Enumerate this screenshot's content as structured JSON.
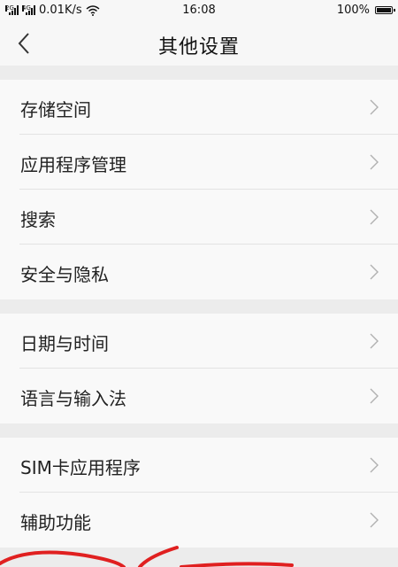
{
  "status_bar": {
    "sim1_tag": "2G",
    "sim2_tag": "4G",
    "net_speed": "0.01K/s",
    "time": "16:08",
    "battery": "100%",
    "icons": [
      "signal-icon",
      "wifi-icon",
      "battery-icon"
    ]
  },
  "header": {
    "title": "其他设置",
    "back_icon": "back-icon"
  },
  "sections": [
    {
      "items": [
        {
          "label": "存储空间"
        },
        {
          "label": "应用程序管理"
        },
        {
          "label": "搜索"
        },
        {
          "label": "安全与隐私"
        }
      ]
    },
    {
      "items": [
        {
          "label": "日期与时间"
        },
        {
          "label": "语言与输入法"
        }
      ]
    },
    {
      "items": [
        {
          "label": "SIM卡应用程序"
        },
        {
          "label": "辅助功能"
        }
      ]
    }
  ],
  "colors": {
    "background": "#f4f4f4",
    "card": "#f9f9f9",
    "separator": "#ececec",
    "chevron": "#b0b0b0",
    "annotation": "#e02020"
  }
}
